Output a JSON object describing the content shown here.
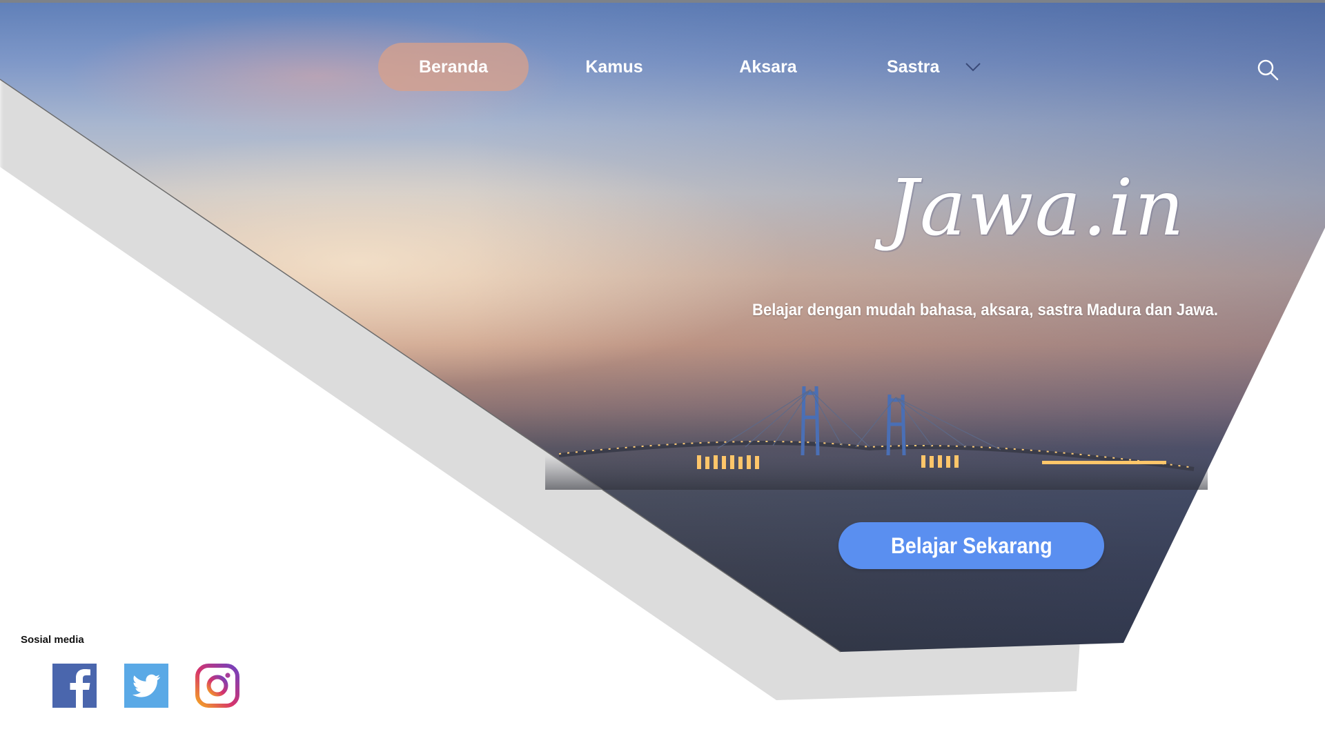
{
  "nav": {
    "items": [
      {
        "label": "Beranda",
        "active": true
      },
      {
        "label": "Kamus",
        "active": false
      },
      {
        "label": "Aksara",
        "active": false
      },
      {
        "label": "Sastra",
        "active": false,
        "has_dropdown": true
      }
    ],
    "search_icon": "search-icon",
    "dropdown_icon": "chevron-down-icon"
  },
  "hero": {
    "logo_text": "Jawa.in",
    "tagline": "Belajar dengan mudah bahasa, aksara, sastra Madura dan Jawa.",
    "cta_label": "Belajar Sekarang",
    "background": "sunset-bridge-photo"
  },
  "social": {
    "label": "Sosial media",
    "items": [
      {
        "name": "facebook",
        "icon": "facebook-icon",
        "color": "#4a66ad"
      },
      {
        "name": "twitter",
        "icon": "twitter-icon",
        "color": "#5aa9e6"
      },
      {
        "name": "instagram",
        "icon": "instagram-icon",
        "color": "#c13584"
      }
    ]
  },
  "colors": {
    "active_pill": "#d6a08c",
    "cta": "#5a8ff0",
    "text_light": "#ffffff"
  }
}
